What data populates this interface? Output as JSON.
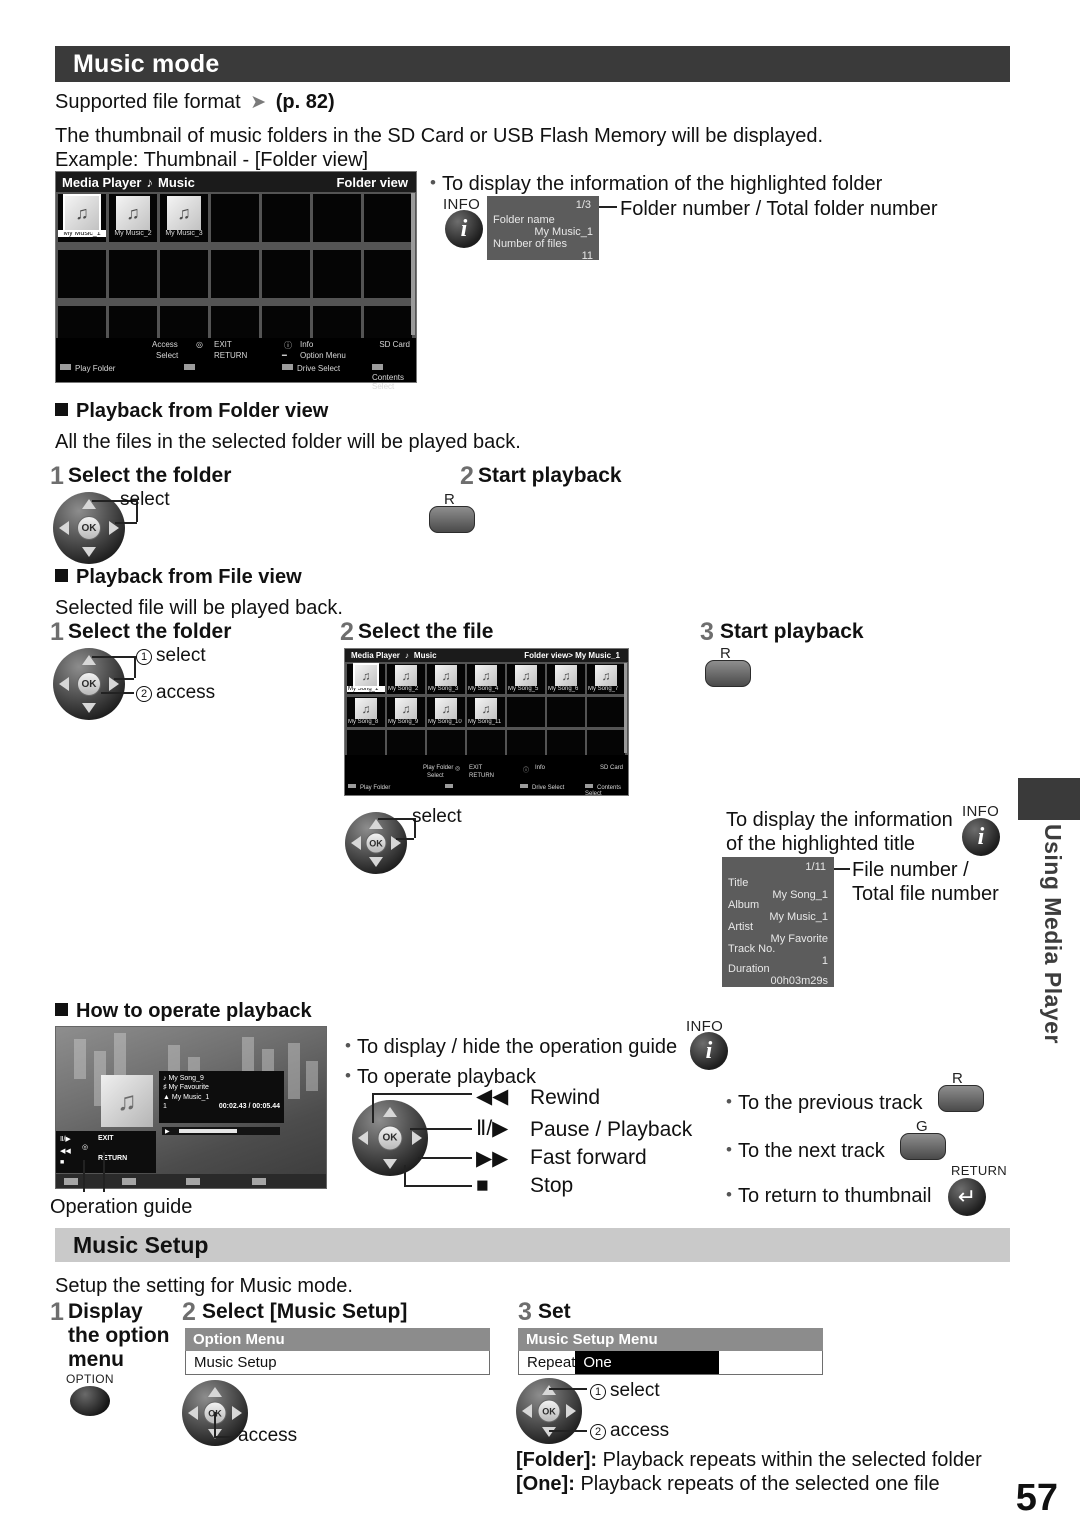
{
  "section1": {
    "title": "Music mode",
    "supported_format_label": "Supported file format",
    "supported_format_ref": "(p. 82)",
    "intro_line1": "The thumbnail of music folders in the SD Card or USB Flash Memory will be displayed.",
    "intro_line2": "Example: Thumbnail - [Folder view]"
  },
  "folder_screen": {
    "app_title": "Media Player",
    "mode": "Music",
    "view": "Folder view",
    "items": [
      "My Music_1",
      "My Music_2",
      "My Music_3"
    ],
    "guide": {
      "access": "Access",
      "select": "Select",
      "exit": "EXIT",
      "return": "RETURN",
      "info": "Info",
      "option_menu": "Option Menu",
      "drive": "SD Card",
      "play_folder": "Play Folder",
      "drive_select": "Drive Select",
      "contents_select": "Contents Select"
    }
  },
  "folder_info": {
    "caption": "To display the information of the highlighted folder",
    "info_label": "INFO",
    "counter": "1/3",
    "callout": "Folder number / Total folder number",
    "rows": [
      {
        "key": "Folder name",
        "value": "My Music_1"
      },
      {
        "key": "Number of files",
        "value": "11"
      }
    ]
  },
  "folder_playback": {
    "heading": "Playback from Folder view",
    "description": "All the files in the selected folder will be played back.",
    "step1_num": "1",
    "step1_text": "Select the folder",
    "step1_callout": "select",
    "step2_num": "2",
    "step2_text": "Start playback",
    "red_key": "R"
  },
  "file_playback": {
    "heading": "Playback from File view",
    "description": "Selected file will be played back.",
    "step1_num": "1",
    "step1_text": "Select the folder",
    "step1_callout1": "select",
    "step1_callout2": "access",
    "step2_num": "2",
    "step2_text": "Select the file",
    "step2_callout": "select",
    "step3_num": "3",
    "step3_text": "Start playback",
    "red_key": "R"
  },
  "file_screen": {
    "app_title": "Media Player",
    "mode": "Music",
    "view": "Folder view> My Music_1",
    "row1": [
      "My Song_1",
      "My Song_2",
      "My Song_3",
      "My Song_4",
      "My Song_5",
      "My Song_6",
      "My Song_7"
    ],
    "row2": [
      "My Song_8",
      "My Song_9",
      "My Song_10",
      "My Song_11"
    ],
    "guide": {
      "access": "Play Folder",
      "select": "Select",
      "exit": "EXIT",
      "return": "RETURN",
      "info": "Info",
      "drive": "SD Card",
      "play_folder": "Play Folder",
      "drive_select": "Drive Select",
      "contents_select": "Contents Select"
    }
  },
  "file_info": {
    "caption_line1": "To display the information",
    "caption_line2": "of the highlighted title",
    "info_label": "INFO",
    "counter": "1/11",
    "callout_line1": "File number /",
    "callout_line2": "Total file number",
    "rows": [
      {
        "key": "Title",
        "value": "My Song_1"
      },
      {
        "key": "Album",
        "value": "My Music_1"
      },
      {
        "key": "Artist",
        "value": "My Favorite"
      },
      {
        "key": "Track No.",
        "value": "1"
      },
      {
        "key": "Duration",
        "value": "00h03m29s"
      }
    ]
  },
  "operate": {
    "heading": "How to operate playback",
    "operation_guide_label": "Operation guide",
    "display_hide_guide": "To display / hide the operation guide",
    "info_label": "INFO",
    "operate_playback": "To operate playback",
    "transport": [
      {
        "glyph": "◀◀",
        "label": "Rewind"
      },
      {
        "glyph": "Ⅱ/▶",
        "label": "Pause / Playback"
      },
      {
        "glyph": "▶▶",
        "label": "Fast forward"
      },
      {
        "glyph": "■",
        "label": "Stop"
      }
    ],
    "previous_track": "To the previous track",
    "previous_key": "R",
    "next_track": "To the next track",
    "next_key": "G",
    "return_thumbnail": "To return to thumbnail",
    "return_label": "RETURN"
  },
  "now_playing": {
    "title": "My Song_9",
    "artist": "My Favourite",
    "album": "My Music_1",
    "track_no": "1",
    "time": "00:02.43 / 00:05.44",
    "exit": "EXIT",
    "return": "RETURN"
  },
  "section2": {
    "title": "Music Setup",
    "description": "Setup the setting for Music mode.",
    "step1_num": "1",
    "step1_line1": "Display",
    "step1_line2": "the option",
    "step1_line3": "menu",
    "option_key_label": "OPTION",
    "step2_num": "2",
    "step2_text": "Select [Music Setup]",
    "step2_callout": "access",
    "step3_num": "3",
    "step3_text": "Set",
    "step3_callout1": "select",
    "step3_callout2": "access",
    "option_menu": {
      "header": "Option Menu",
      "row": "Music Setup"
    },
    "setup_menu": {
      "header": "Music Setup Menu",
      "row_key": "Repeat",
      "row_value": "One"
    },
    "note_folder": "[Folder]: Playback repeats within the selected folder",
    "note_one": "[One]: Playback repeats of the selected one file"
  },
  "side_tab": {
    "label": "Using Media Player"
  },
  "footer": {
    "page_number": "57"
  },
  "colors": {
    "banner_dark": "#3a3a3a",
    "banner_gray": "#c9c9c9",
    "screen_bg": "#545454",
    "info_panel": "#5c5c5c",
    "menu_header": "#8c8c8c"
  }
}
